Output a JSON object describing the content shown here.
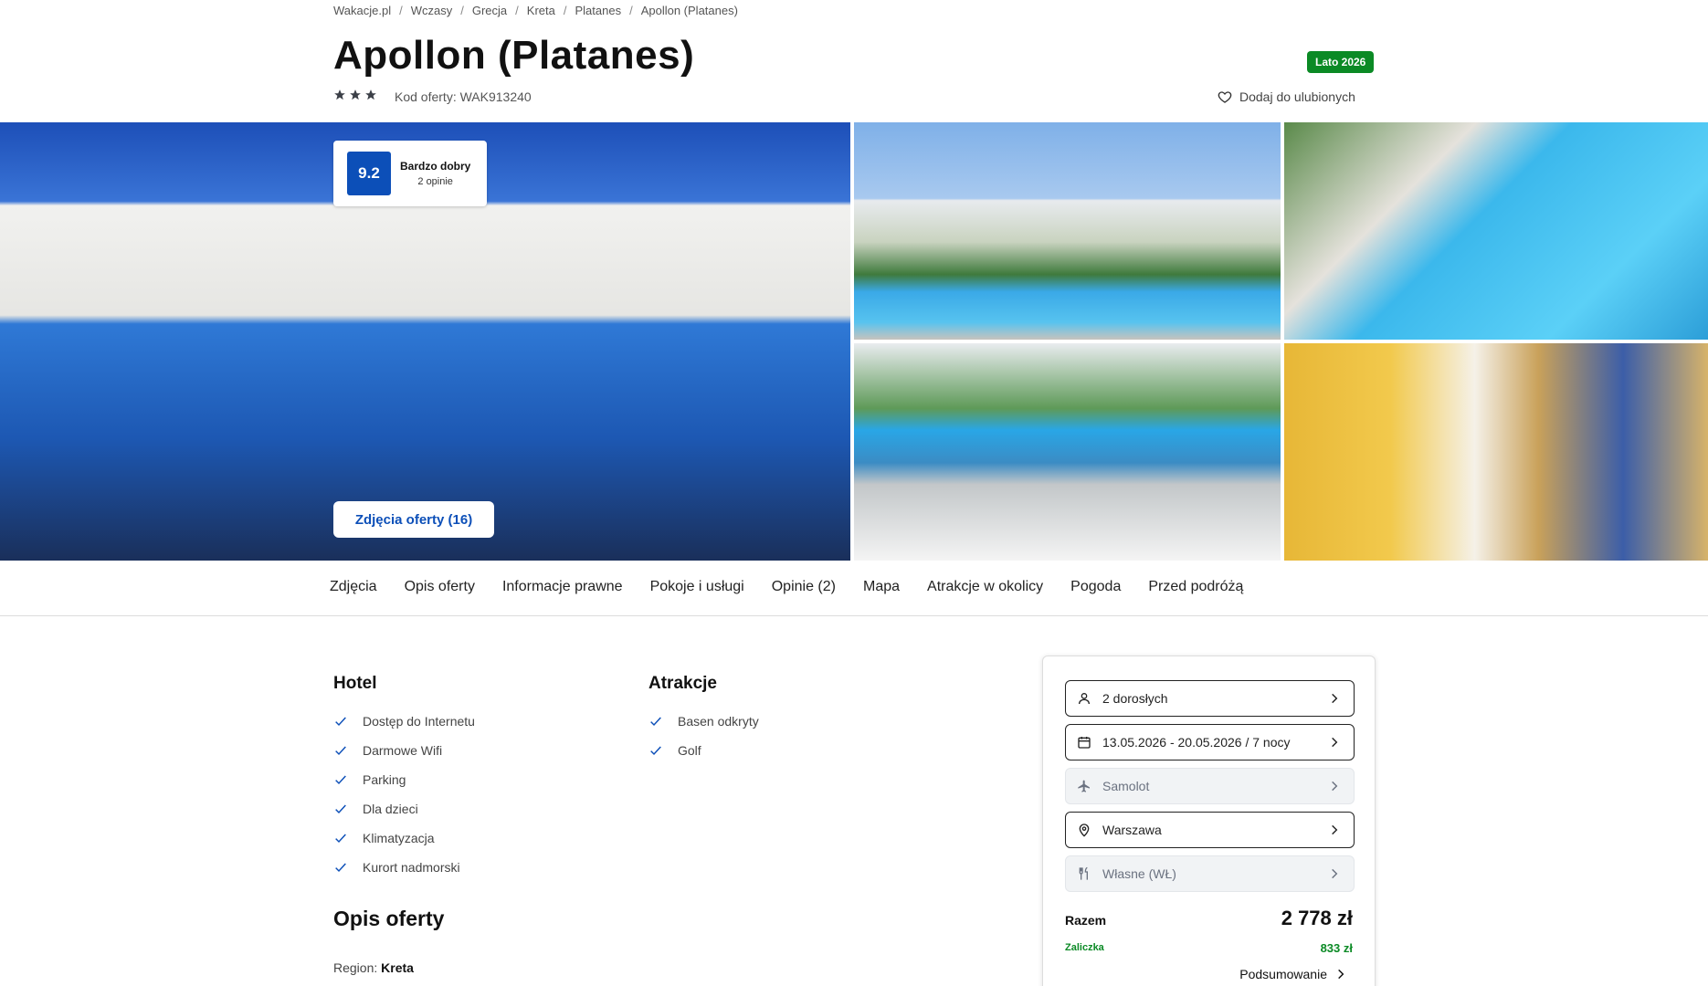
{
  "breadcrumb": [
    "Wakacje.pl",
    "Wczasy",
    "Grecja",
    "Kreta",
    "Platanes",
    "Apollon (Platanes)"
  ],
  "hotel": {
    "name": "Apollon (Platanes)",
    "season_badge": "Lato 2026",
    "stars": 3,
    "offer_code": "Kod oferty: WAK913240",
    "favorite_label": "Dodaj do ulubionych"
  },
  "rating": {
    "score": "9.2",
    "label": "Bardzo dobry",
    "count": "2 opinie"
  },
  "gallery": {
    "photos_button": "Zdjęcia oferty (16)"
  },
  "tabs": [
    "Zdjęcia",
    "Opis oferty",
    "Informacje prawne",
    "Pokoje i usługi",
    "Opinie (2)",
    "Mapa",
    "Atrakcje w okolicy",
    "Pogoda",
    "Przed podróżą"
  ],
  "amenities": {
    "hotel": {
      "title": "Hotel",
      "items": [
        "Dostęp do Internetu",
        "Darmowe Wifi",
        "Parking",
        "Dla dzieci",
        "Klimatyzacja",
        "Kurort nadmorski"
      ]
    },
    "attractions": {
      "title": "Atrakcje",
      "items": [
        "Basen odkryty",
        "Golf"
      ]
    }
  },
  "description": {
    "title": "Opis oferty",
    "region_label": "Region:",
    "region_value": "Kreta"
  },
  "booking": {
    "travelers": "2 dorosłych",
    "dates": "13.05.2026 - 20.05.2026 / 7 nocy",
    "transport": "Samolot",
    "departure": "Warszawa",
    "board": "Własne (WŁ)",
    "total_label": "Razem",
    "total_value": "2 778 zł",
    "deposit_label": "Zaliczka",
    "deposit_value": "833 zł",
    "summary_label": "Podsumowanie"
  },
  "colors": {
    "brand_blue": "#0c4fb8",
    "green": "#0b8a25",
    "star": "#3b3f47"
  }
}
